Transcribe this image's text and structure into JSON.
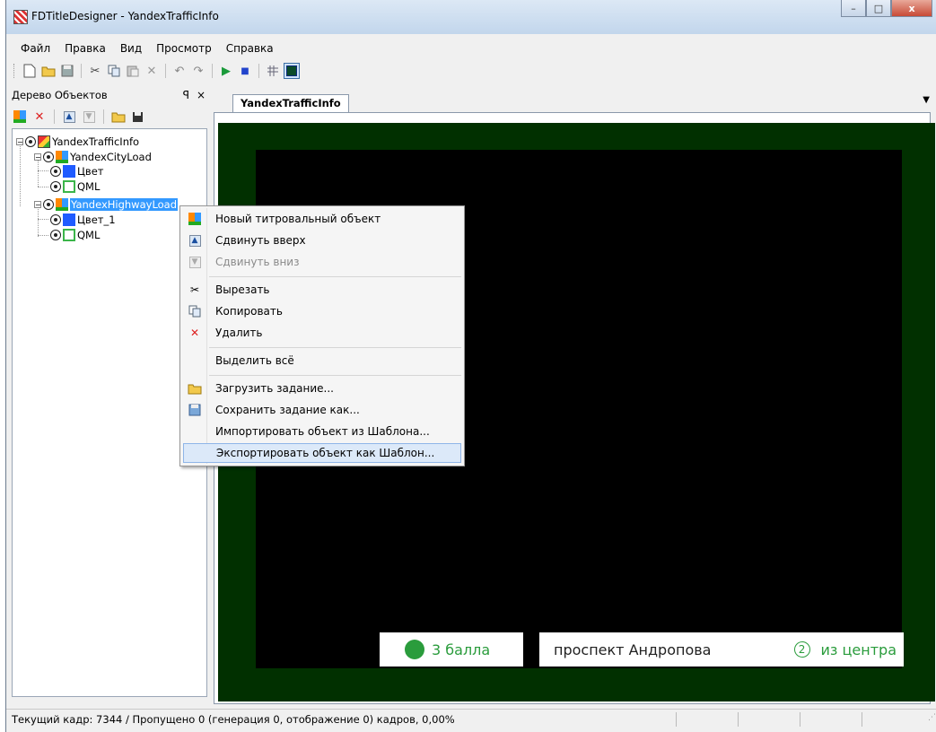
{
  "window": {
    "title": "FDTitleDesigner - YandexTrafficInfo",
    "minimize_glyph": "–",
    "maximize_glyph": "□",
    "close_glyph": "x"
  },
  "menu": {
    "items": [
      "Файл",
      "Правка",
      "Вид",
      "Просмотр",
      "Справка"
    ]
  },
  "toolbar": {
    "icons": [
      "new-file-icon",
      "open-folder-icon",
      "save-icon",
      "cut-icon",
      "copy-icon",
      "paste-icon",
      "delete-icon",
      "undo-icon",
      "redo-icon",
      "play-icon",
      "stop-icon",
      "grid-icon",
      "preview-frame-icon"
    ]
  },
  "left_panel": {
    "title": "Дерево Объектов",
    "pin_glyph": "ᵖ",
    "close_glyph": "×",
    "toolbar_icons": [
      "new-object-icon",
      "delete-icon",
      "move-up-icon",
      "move-down-icon",
      "load-task-icon",
      "save-task-icon"
    ]
  },
  "tree": {
    "root": "YandexTrafficInfo",
    "city_load": "YandexCityLoad",
    "city_color": "Цвет",
    "city_qml": "QML",
    "highway_load": "YandexHighwayLoad",
    "highway_color": "Цвет_1",
    "highway_qml": "QML"
  },
  "document": {
    "tab": "YandexTrafficInfo",
    "dropdown_glyph": "▼"
  },
  "preview": {
    "score_text": "3 балла",
    "road_name": "проспект Андропова",
    "direction_number": "2",
    "direction_text": "из центра",
    "colors": {
      "background": "#013000",
      "inner": "#000000",
      "accent": "#2a9c3c"
    }
  },
  "context_menu": {
    "new_object": "Новый титровальный объект",
    "move_up": "Сдвинуть вверх",
    "move_down": "Сдвинуть вниз",
    "cut": "Вырезать",
    "copy": "Копировать",
    "delete": "Удалить",
    "select_all": "Выделить всё",
    "load_task": "Загрузить задание...",
    "save_task_as": "Сохранить задание как...",
    "import_template": "Импортировать объект из Шаблона...",
    "export_template": "Экспортировать объект как  Шаблон..."
  },
  "statusbar": {
    "text": "Текущий кадр: 7344 / Пропущено 0 (генерация 0, отображение 0) кадров,  0,00%"
  }
}
